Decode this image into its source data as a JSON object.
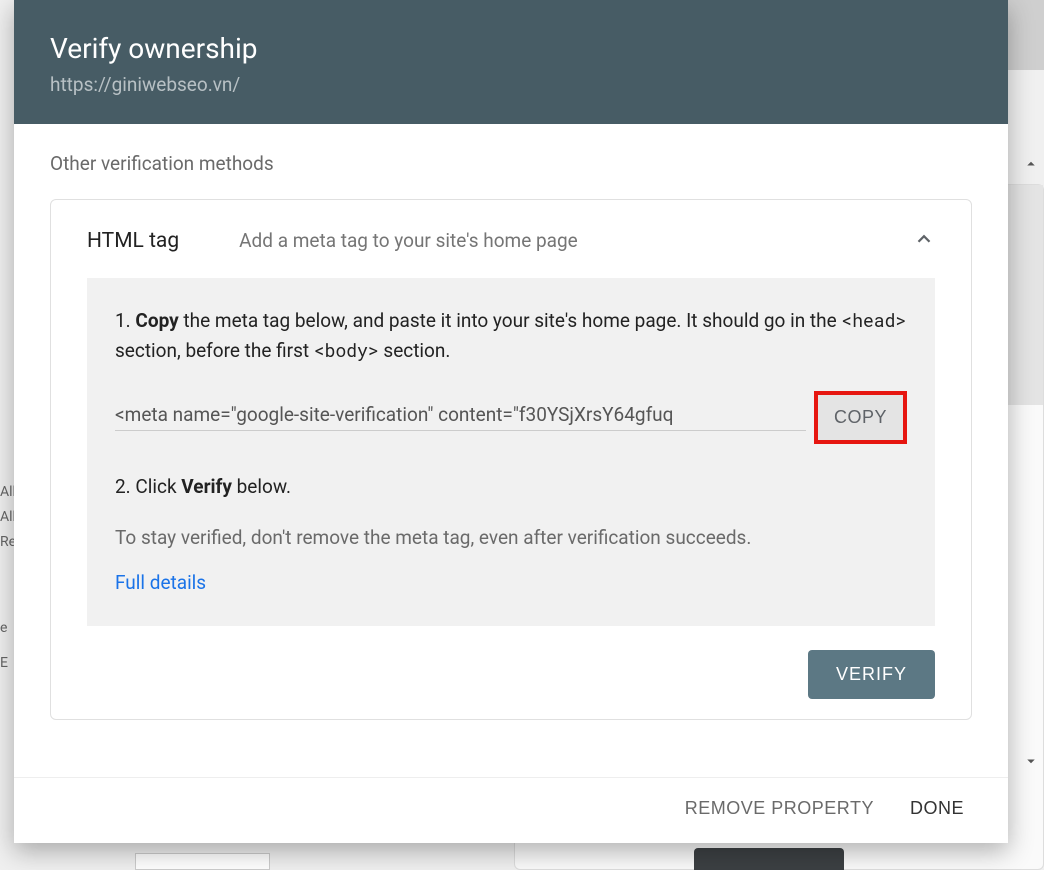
{
  "header": {
    "title": "Verify ownership",
    "subtitle": "https://giniwebseo.vn/"
  },
  "body": {
    "section_title": "Other verification methods",
    "method": {
      "name": "HTML tag",
      "description": "Add a meta tag to your site's home page",
      "step1_prefix": "1. ",
      "step1_bold": "Copy",
      "step1_text_a": " the meta tag below, and paste it into your site's home page. It should go in the ",
      "step1_code_a": "<head>",
      "step1_text_b": " section, before the first ",
      "step1_code_b": "<body>",
      "step1_text_c": " section.",
      "meta_tag": "<meta name=\"google-site-verification\" content=\"f30YSjXrsY64gfuq",
      "copy_label": "COPY",
      "step2_prefix": "2. Click ",
      "step2_bold": "Verify",
      "step2_suffix": " below.",
      "note": "To stay verified, don't remove the meta tag, even after verification succeeds.",
      "full_details": "Full details",
      "verify_label": "VERIFY"
    }
  },
  "footer": {
    "remove_label": "REMOVE PROPERTY",
    "done_label": "DONE"
  },
  "backdrop": {
    "line1": "All",
    "line2": "All",
    "line3": "Re",
    "line4": "e",
    "line5": "E"
  }
}
